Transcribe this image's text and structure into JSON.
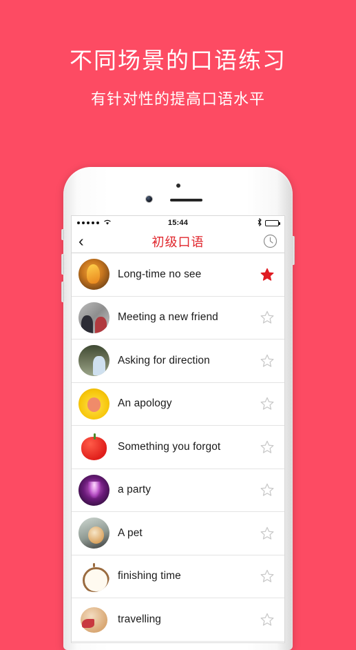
{
  "promo": {
    "title": "不同场景的口语练习",
    "subtitle": "有针对性的提高口语水平",
    "background_color": "#fd4b63",
    "text_color": "#ffffff"
  },
  "phone": {
    "sensor_icon": "proximity-sensor-dot",
    "camera_icon": "front-camera-lens",
    "speaker_icon": "earpiece-speaker",
    "side_buttons": [
      "mute-switch",
      "volume-up",
      "volume-down",
      "power"
    ]
  },
  "status_bar": {
    "signal_dots": 5,
    "wifi_icon": "wifi-icon",
    "time": "15:44",
    "bluetooth_icon": "bluetooth-icon",
    "battery_icon": "battery-icon",
    "battery_level": "40%"
  },
  "nav_bar": {
    "back_icon": "chevron-left-icon",
    "back_glyph": "‹",
    "title": "初级口语",
    "title_color": "#e0262c",
    "right_icon": "clock-icon"
  },
  "list": {
    "star_filled_color": "#e01b22",
    "star_empty_color": "#c9c9c9",
    "rows": [
      {
        "label": "Long-time no see",
        "avatar": "rooster-photo",
        "avatar_class": "av-rooster",
        "favorited": true
      },
      {
        "label": "Meeting a new friend",
        "avatar": "friends-photo",
        "avatar_class": "av-friends",
        "favorited": false
      },
      {
        "label": "Asking for direction",
        "avatar": "direction-photo",
        "avatar_class": "av-direction",
        "favorited": false
      },
      {
        "label": "An apology",
        "avatar": "crying-emoji",
        "avatar_class": "av-apology",
        "favorited": false
      },
      {
        "label": "Something you forgot",
        "avatar": "red-apple-icon",
        "avatar_class": "av-apple",
        "favorited": false
      },
      {
        "label": "a party",
        "avatar": "fireworks-photo",
        "avatar_class": "av-party",
        "favorited": false
      },
      {
        "label": "A pet",
        "avatar": "dog-photo",
        "avatar_class": "av-pet",
        "favorited": false
      },
      {
        "label": "finishing time",
        "avatar": "pocket-watch-icon",
        "avatar_class": "av-watch",
        "favorited": false
      },
      {
        "label": "travelling",
        "avatar": "globe-plane-icon",
        "avatar_class": "av-travel",
        "favorited": false
      }
    ]
  }
}
